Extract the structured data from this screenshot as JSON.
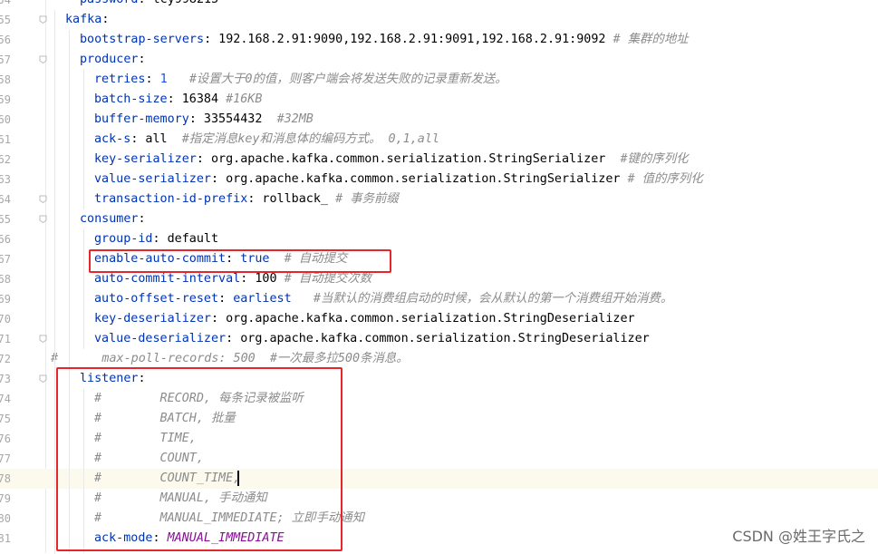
{
  "editor": {
    "lines": [
      {
        "num": "54",
        "indent": 88,
        "fold": false,
        "parts": [
          [
            "ka",
            "password"
          ],
          [
            "v",
            ": tcy998215"
          ]
        ]
      },
      {
        "num": "55",
        "indent": 72,
        "fold": true,
        "parts": [
          [
            "ka",
            "kafka"
          ],
          [
            "v",
            ":"
          ]
        ]
      },
      {
        "num": "56",
        "indent": 88,
        "fold": false,
        "parts": [
          [
            "ka",
            "bootstrap-servers"
          ],
          [
            "v",
            ": 192.168.2.91:9090,192.168.2.91:9091,192.168.2.91:9092 "
          ],
          [
            "c",
            "# 集群的地址"
          ]
        ]
      },
      {
        "num": "57",
        "indent": 88,
        "fold": true,
        "parts": [
          [
            "ka",
            "producer"
          ],
          [
            "v",
            ":"
          ]
        ]
      },
      {
        "num": "58",
        "indent": 104,
        "fold": false,
        "parts": [
          [
            "ka",
            "retries"
          ],
          [
            "v",
            ": "
          ],
          [
            "num",
            "1"
          ],
          [
            "v",
            "   "
          ],
          [
            "c",
            "#设置大于0的值，则客户端会将发送失败的记录重新发送。"
          ]
        ]
      },
      {
        "num": "59",
        "indent": 104,
        "fold": false,
        "parts": [
          [
            "ka",
            "batch-size"
          ],
          [
            "v",
            ": 16384 "
          ],
          [
            "c",
            "#16KB"
          ]
        ]
      },
      {
        "num": "60",
        "indent": 104,
        "fold": false,
        "parts": [
          [
            "ka",
            "buffer-memory"
          ],
          [
            "v",
            ": 33554432  "
          ],
          [
            "c",
            "#32MB"
          ]
        ]
      },
      {
        "num": "61",
        "indent": 104,
        "fold": false,
        "parts": [
          [
            "ka",
            "ack-s"
          ],
          [
            "v",
            ": all  "
          ],
          [
            "c",
            "#指定消息key和消息体的编码方式。 0,1,all"
          ]
        ]
      },
      {
        "num": "62",
        "indent": 104,
        "fold": false,
        "parts": [
          [
            "ka",
            "key-serializer"
          ],
          [
            "v",
            ": org.apache.kafka.common.serialization.StringSerializer  "
          ],
          [
            "c",
            "#键的序列化"
          ]
        ]
      },
      {
        "num": "63",
        "indent": 104,
        "fold": false,
        "parts": [
          [
            "ka",
            "value-serializer"
          ],
          [
            "v",
            ": org.apache.kafka.common.serialization.StringSerializer "
          ],
          [
            "c",
            "# 值的序列化"
          ]
        ]
      },
      {
        "num": "64",
        "indent": 104,
        "fold": true,
        "parts": [
          [
            "ka",
            "transaction-id-prefix"
          ],
          [
            "v",
            ": rollback_ "
          ],
          [
            "c",
            "# 事务前缀"
          ]
        ]
      },
      {
        "num": "65",
        "indent": 88,
        "fold": true,
        "parts": [
          [
            "ka",
            "consumer"
          ],
          [
            "v",
            ":"
          ]
        ]
      },
      {
        "num": "66",
        "indent": 104,
        "fold": false,
        "parts": [
          [
            "ka",
            "group-id"
          ],
          [
            "v",
            ": default"
          ]
        ]
      },
      {
        "num": "67",
        "indent": 104,
        "fold": false,
        "parts": [
          [
            "ka",
            "enable-auto-commit"
          ],
          [
            "v",
            ": "
          ],
          [
            "ka",
            "true"
          ],
          [
            "v",
            "  "
          ],
          [
            "c",
            "# 自动提交"
          ]
        ]
      },
      {
        "num": "68",
        "indent": 104,
        "fold": false,
        "parts": [
          [
            "ka",
            "auto-commit-interval"
          ],
          [
            "v",
            ": 100 "
          ],
          [
            "c",
            "# 自动提交次数"
          ]
        ]
      },
      {
        "num": "69",
        "indent": 104,
        "fold": false,
        "parts": [
          [
            "ka",
            "auto-offset-reset"
          ],
          [
            "v",
            ": "
          ],
          [
            "ka",
            "earliest"
          ],
          [
            "v",
            "   "
          ],
          [
            "c",
            "#当默认的消费组启动的时候，会从默认的第一个消费组开始消费。"
          ]
        ]
      },
      {
        "num": "70",
        "indent": 104,
        "fold": false,
        "parts": [
          [
            "ka",
            "key-deserializer"
          ],
          [
            "v",
            ": org.apache.kafka.common.serialization.StringDeserializer"
          ]
        ]
      },
      {
        "num": "71",
        "indent": 104,
        "fold": true,
        "parts": [
          [
            "ka",
            "value-deserializer"
          ],
          [
            "v",
            ": org.apache.kafka.common.serialization.StringDeserializer"
          ]
        ]
      },
      {
        "num": "72",
        "indent": 56,
        "fold": false,
        "parts": [
          [
            "c",
            "#      max-poll-records: 500  #一次最多拉500条消息。"
          ]
        ]
      },
      {
        "num": "73",
        "indent": 88,
        "fold": true,
        "parts": [
          [
            "ka",
            "listener"
          ],
          [
            "v",
            ":"
          ]
        ]
      },
      {
        "num": "74",
        "indent": 104,
        "fold": false,
        "parts": [
          [
            "c",
            "#        RECORD, 每条记录被监听"
          ]
        ]
      },
      {
        "num": "75",
        "indent": 104,
        "fold": false,
        "parts": [
          [
            "c",
            "#        BATCH, 批量"
          ]
        ]
      },
      {
        "num": "76",
        "indent": 104,
        "fold": false,
        "parts": [
          [
            "c",
            "#        TIME,"
          ]
        ]
      },
      {
        "num": "77",
        "indent": 104,
        "fold": false,
        "parts": [
          [
            "c",
            "#        COUNT,"
          ]
        ]
      },
      {
        "num": "78",
        "indent": 104,
        "fold": false,
        "parts": [
          [
            "c",
            "#        COUNT_TIME,"
          ]
        ]
      },
      {
        "num": "79",
        "indent": 104,
        "fold": false,
        "parts": [
          [
            "c",
            "#        MANUAL, 手动通知"
          ]
        ]
      },
      {
        "num": "80",
        "indent": 104,
        "fold": false,
        "parts": [
          [
            "c",
            "#        MANUAL_IMMEDIATE; 立即手动通知"
          ]
        ]
      },
      {
        "num": "81",
        "indent": 104,
        "fold": false,
        "parts": [
          [
            "ka",
            "ack-mode"
          ],
          [
            "v",
            ": "
          ],
          [
            "enum",
            "MANUAL_IMMEDIATE"
          ]
        ]
      }
    ],
    "current_line": "78"
  },
  "watermark": "CSDN @姓王字氏之"
}
